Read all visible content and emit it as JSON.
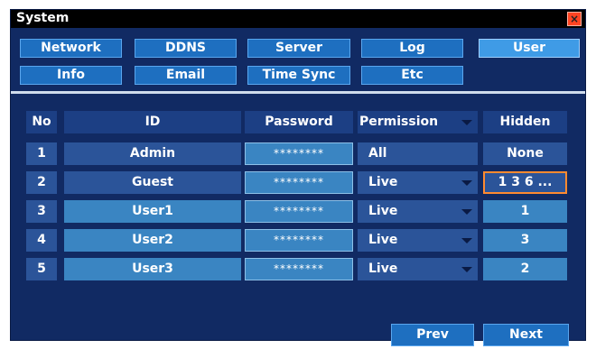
{
  "window": {
    "title": "System"
  },
  "tabs": {
    "row1": [
      "Network",
      "DDNS",
      "Server",
      "Log",
      "User"
    ],
    "row2": [
      "Info",
      "Email",
      "Time Sync",
      "Etc"
    ],
    "selected": "User"
  },
  "table": {
    "headers": {
      "no": "No",
      "id": "ID",
      "password": "Password",
      "permission": "Permission",
      "hidden": "Hidden"
    },
    "rows": [
      {
        "no": "1",
        "id": "Admin",
        "password": "********",
        "permission": "All",
        "hidden": "None"
      },
      {
        "no": "2",
        "id": "Guest",
        "password": "********",
        "permission": "Live",
        "hidden": "1 3 6 ..."
      },
      {
        "no": "3",
        "id": "User1",
        "password": "********",
        "permission": "Live",
        "hidden": "1"
      },
      {
        "no": "4",
        "id": "User2",
        "password": "********",
        "permission": "Live",
        "hidden": "3"
      },
      {
        "no": "5",
        "id": "User3",
        "password": "********",
        "permission": "Live",
        "hidden": "2"
      }
    ]
  },
  "footer": {
    "prev_label": "Prev",
    "next_label": "Next"
  },
  "colors": {
    "background": "#112a63",
    "button": "#1e6fc0",
    "selected_outline": "#ff8a30",
    "close": "#ff4422"
  },
  "icons": {
    "close": "close-icon",
    "dropdown": "chevron-down-icon"
  }
}
